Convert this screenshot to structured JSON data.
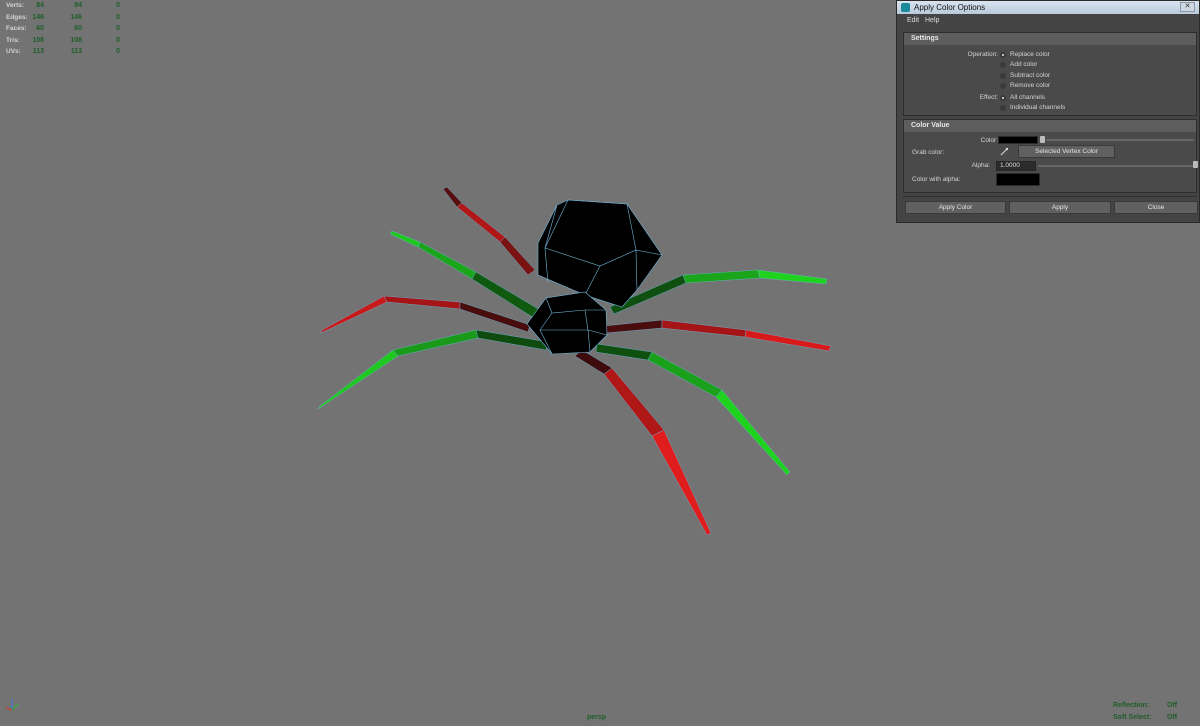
{
  "hud": {
    "rows": [
      {
        "label": "Verts:",
        "a": "84",
        "b": "84",
        "c": "0"
      },
      {
        "label": "Edges:",
        "a": "146",
        "b": "146",
        "c": "0"
      },
      {
        "label": "Faces:",
        "a": "60",
        "b": "60",
        "c": "0"
      },
      {
        "label": "Tris:",
        "a": "108",
        "b": "108",
        "c": "0"
      },
      {
        "label": "UVs:",
        "a": "113",
        "b": "113",
        "c": "0"
      }
    ]
  },
  "viewport": {
    "camera": "persp",
    "reflection_label": "Reflection:",
    "reflection_value": "Off",
    "soft_select_label": "Soft Select:",
    "soft_select_value": "Off",
    "colors": {
      "background": "#737373",
      "red_leg": "#d91a1a",
      "green_leg": "#1ec81e",
      "body": "#000000",
      "wire": "#6fb6d8"
    }
  },
  "dialog": {
    "title": "Apply Color Options",
    "close_glyph": "✕",
    "menu": [
      "Edit",
      "Help"
    ],
    "settings": {
      "header": "Settings",
      "operation_label": "Operation:",
      "operations": [
        "Replace color",
        "Add color",
        "Subtract color",
        "Remove color"
      ],
      "operation_selected": "Replace color",
      "effect_label": "Effect:",
      "effects": [
        "All channels",
        "Individual channels"
      ],
      "effect_selected": "All channels"
    },
    "color_value": {
      "header": "Color Value",
      "color_label": "Color:",
      "color": "#000000",
      "grab_label": "Grab color:",
      "grab_button": "Selected Vertex Color",
      "alpha_label": "Alpha:",
      "alpha_value": "1.0000",
      "alpha_fraction": 1.0,
      "color_with_alpha_label": "Color with alpha:"
    },
    "buttons": {
      "apply_color": "Apply Color",
      "apply": "Apply",
      "close": "Close"
    }
  }
}
